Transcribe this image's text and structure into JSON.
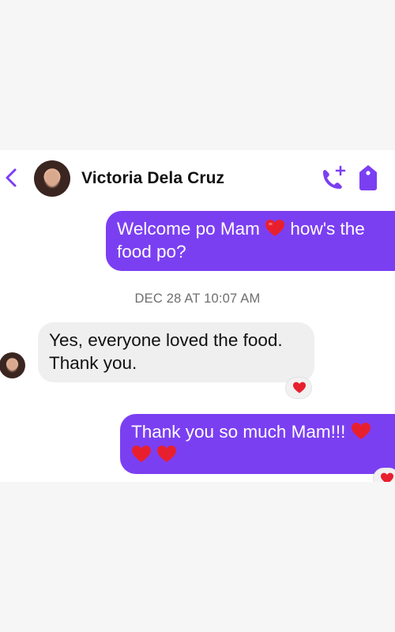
{
  "header": {
    "contact_name": "Victoria Dela Cruz",
    "back_icon": "chevron-left-icon",
    "call_icon": "add-call-icon",
    "tag_icon": "tag-icon",
    "accent_color": "#7b3ff2"
  },
  "messages": [
    {
      "direction": "outgoing",
      "text_part1": "Welcome po Mam",
      "text_part2": "how's the",
      "text_line2": "food po?"
    },
    {
      "direction": "incoming",
      "text_line1": "Yes, everyone loved the food.",
      "text_line2": "Thank you.",
      "reaction": "heart"
    },
    {
      "direction": "outgoing",
      "text_line1": "Thank you so much Mam!!!",
      "reaction": "heart"
    }
  ],
  "timestamp": "DEC 28 AT 10:07 AM"
}
